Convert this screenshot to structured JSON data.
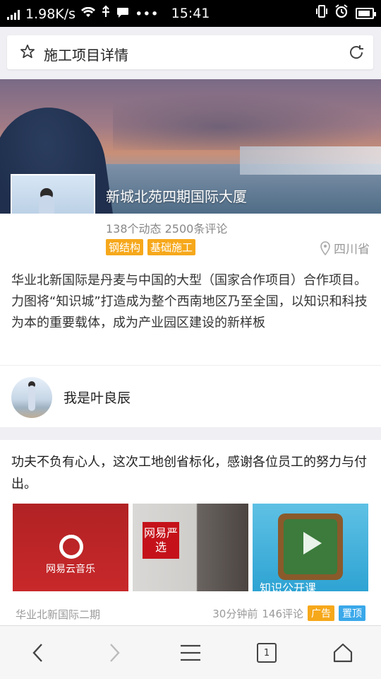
{
  "status_bar": {
    "speed": "1.98K/s",
    "time": "15:41",
    "more": "•••"
  },
  "header": {
    "title": "施工项目详情"
  },
  "project": {
    "name": "新城北苑四期国际大厦",
    "stats": "138个动态 2500条评论",
    "tags": [
      "钢结构",
      "基础施工"
    ],
    "location": "四川省",
    "description": "华业北新国际是丹麦与中国的大型（国家合作项目）合作项目。力图将“知识城”打造成为整个西南地区乃至全国，以知识和科技为本的重要载体，成为产业园区建设的新样板"
  },
  "user": {
    "name": "我是叶良辰"
  },
  "post": {
    "text": "功夫不负有心人，这次工地创省标化，感谢各位员工的努力与付出。",
    "thumbs": [
      {
        "caption": "网易云音乐"
      },
      {
        "caption": "网易严选"
      },
      {
        "caption": "知识公开课"
      }
    ],
    "source": "华业北新国际二期",
    "time": "30分钟前",
    "comments": "146评论",
    "badge_ad": "广告",
    "badge_top": "置顶"
  },
  "bottom_nav": {
    "tab_count": "1"
  }
}
